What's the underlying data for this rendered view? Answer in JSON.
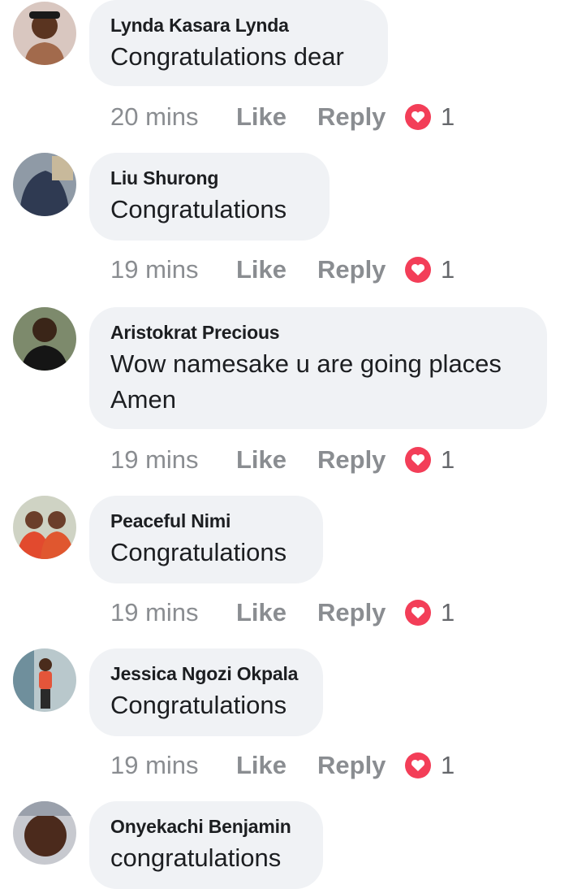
{
  "comments": [
    {
      "author": "Lynda Kasara Lynda",
      "text": "Congratulations dear",
      "time": "20 mins",
      "like_label": "Like",
      "reply_label": "Reply",
      "reaction_count": "1"
    },
    {
      "author": "Liu Shurong",
      "text": "Congratulations",
      "time": "19 mins",
      "like_label": "Like",
      "reply_label": "Reply",
      "reaction_count": "1"
    },
    {
      "author": "Aristokrat Precious",
      "text": "Wow namesake u are going places Amen",
      "time": "19 mins",
      "like_label": "Like",
      "reply_label": "Reply",
      "reaction_count": "1"
    },
    {
      "author": "Peaceful Nimi",
      "text": "Congratulations",
      "time": "19 mins",
      "like_label": "Like",
      "reply_label": "Reply",
      "reaction_count": "1"
    },
    {
      "author": "Jessica Ngozi Okpala",
      "text": "Congratulations",
      "time": "19 mins",
      "like_label": "Like",
      "reply_label": "Reply",
      "reaction_count": "1"
    },
    {
      "author": "Onyekachi Benjamin",
      "text": "congratulations",
      "time": "",
      "like_label": "",
      "reply_label": "",
      "reaction_count": ""
    }
  ],
  "reaction_icon": "love-heart-icon",
  "colors": {
    "bubble": "#f0f2f5",
    "meta_text": "#8a8d91",
    "heart": "#f33e58",
    "name_text": "#1c1e21"
  }
}
